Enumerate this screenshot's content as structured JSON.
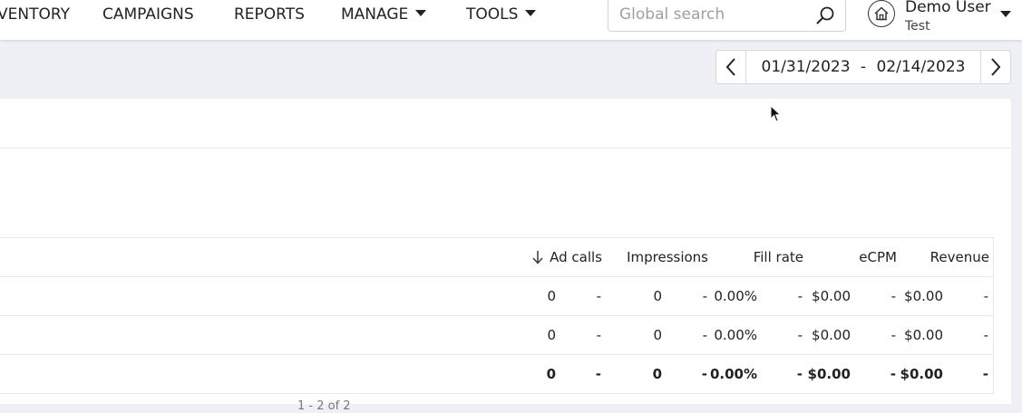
{
  "nav": {
    "items": [
      {
        "label": "VENTORY"
      },
      {
        "label": "CAMPAIGNS"
      },
      {
        "label": "REPORTS"
      },
      {
        "label": "MANAGE"
      },
      {
        "label": "TOOLS"
      }
    ]
  },
  "search": {
    "placeholder": "Global search",
    "icon": "search-icon"
  },
  "user": {
    "name": "Demo User",
    "account": "Test",
    "icon": "home-icon"
  },
  "date_range": {
    "start": "01/31/2023",
    "separator": "-",
    "end": "02/14/2023"
  },
  "table": {
    "columns": [
      "Ad calls",
      "Impressions",
      "Fill rate",
      "eCPM",
      "Revenue"
    ],
    "sort_column": "Ad calls",
    "sort_direction": "descending",
    "rows": [
      {
        "ad_calls": "0",
        "ad_calls_delta": "-",
        "impressions": "0",
        "impressions_delta": "-",
        "fill_rate": "0.00%",
        "fill_rate_delta": "-",
        "ecpm": "$0.00",
        "ecpm_delta": "-",
        "revenue": "$0.00",
        "revenue_delta": "-"
      },
      {
        "ad_calls": "0",
        "ad_calls_delta": "-",
        "impressions": "0",
        "impressions_delta": "-",
        "fill_rate": "0.00%",
        "fill_rate_delta": "-",
        "ecpm": "$0.00",
        "ecpm_delta": "-",
        "revenue": "$0.00",
        "revenue_delta": "-"
      }
    ],
    "total": {
      "ad_calls": "0",
      "ad_calls_delta": "-",
      "impressions": "0",
      "impressions_delta": "-",
      "fill_rate": "0.00%",
      "fill_rate_delta": "-",
      "ecpm": "$0.00",
      "ecpm_delta": "-",
      "revenue": "$0.00",
      "revenue_delta": "-"
    }
  },
  "pagination": {
    "text": "1 - 2 of 2"
  }
}
